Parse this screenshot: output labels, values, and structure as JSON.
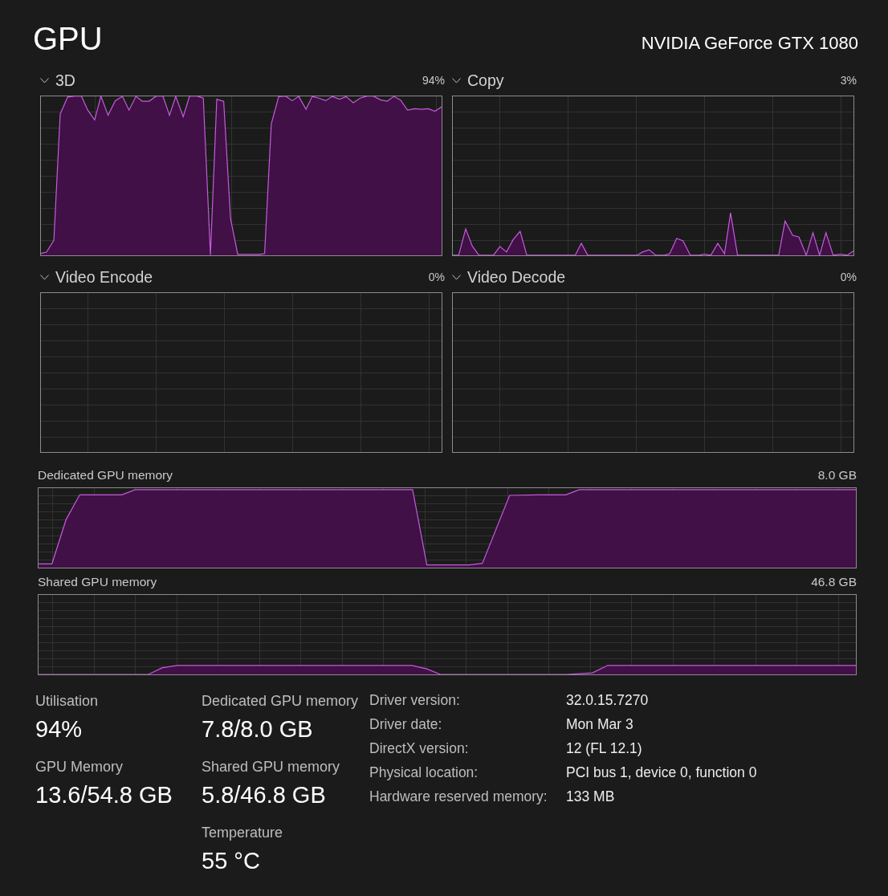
{
  "window": {
    "title": "GPU",
    "device": "NVIDIA GeForce GTX 1080"
  },
  "engines": [
    {
      "name": "3D",
      "reading": "94%"
    },
    {
      "name": "Copy",
      "reading": "3%"
    },
    {
      "name": "Video Encode",
      "reading": "0%"
    },
    {
      "name": "Video Decode",
      "reading": "0%"
    }
  ],
  "memory_graphs": [
    {
      "label": "Dedicated GPU memory",
      "reading": "8.0 GB"
    },
    {
      "label": "Shared GPU memory",
      "reading": "46.8 GB"
    }
  ],
  "stats_columns": [
    [
      {
        "label": "Utilisation",
        "value": "94%"
      },
      {
        "label": "GPU Memory",
        "value": "13.6/54.8 GB"
      }
    ],
    [
      {
        "label": "Dedicated GPU memory",
        "value": "7.8/8.0 GB"
      },
      {
        "label": "Shared GPU memory",
        "value": "5.8/46.8 GB"
      },
      {
        "label": "Temperature",
        "value": "55 °C"
      }
    ]
  ],
  "details": [
    {
      "label": "Driver version:",
      "value": "32.0.15.7270"
    },
    {
      "label": "Driver date:",
      "value": "Mon Mar 3"
    },
    {
      "label": "DirectX version:",
      "value": "12 (FL 12.1)"
    },
    {
      "label": "Physical location:",
      "value": "PCI bus 1, device 0, function 0"
    },
    {
      "label": "Hardware reserved memory:",
      "value": "133 MB"
    }
  ]
}
